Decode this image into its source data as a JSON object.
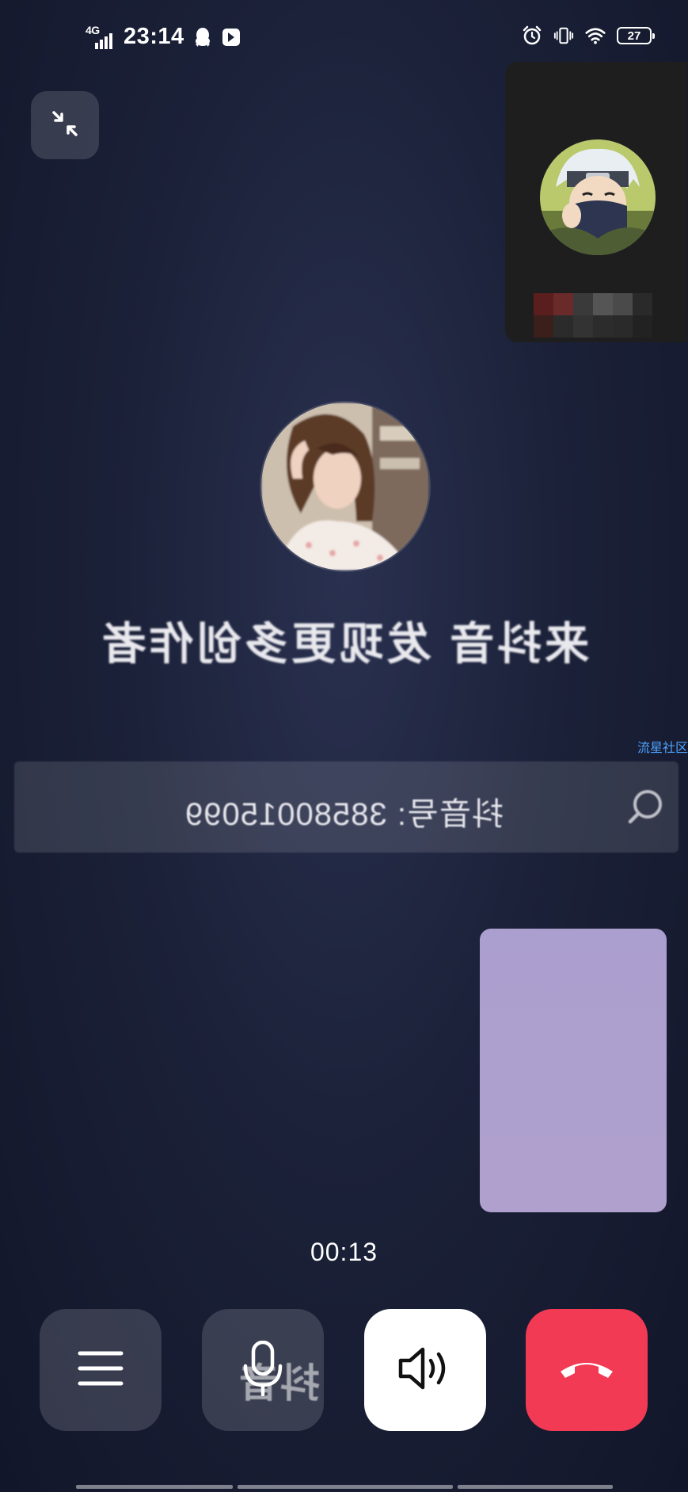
{
  "status_bar": {
    "network_type": "4G",
    "time": "23:14",
    "battery_level": "27",
    "icons_left": [
      "signal-icon",
      "qq-icon",
      "app-icon"
    ],
    "icons_right": [
      "alarm-icon",
      "vibrate-icon",
      "wifi-icon",
      "battery-icon"
    ]
  },
  "call": {
    "minimize_icon": "minimize-icon",
    "slogan": "来抖音 发现更多创作者",
    "search_text": "抖音号: 38580015099",
    "watermark": "流星社区",
    "timer": "00:13",
    "logo_overlay_text": "抖音"
  },
  "controls": {
    "menu_icon": "menu-icon",
    "mic_icon": "microphone-icon",
    "speaker_icon": "speaker-icon",
    "hangup_icon": "hangup-icon"
  },
  "colors": {
    "hangup": "#f23a55",
    "speaker_bg": "#ffffff",
    "remote_preview": "#ab9fcf",
    "background": "#1b2138",
    "watermark": "#4ea3ff"
  }
}
